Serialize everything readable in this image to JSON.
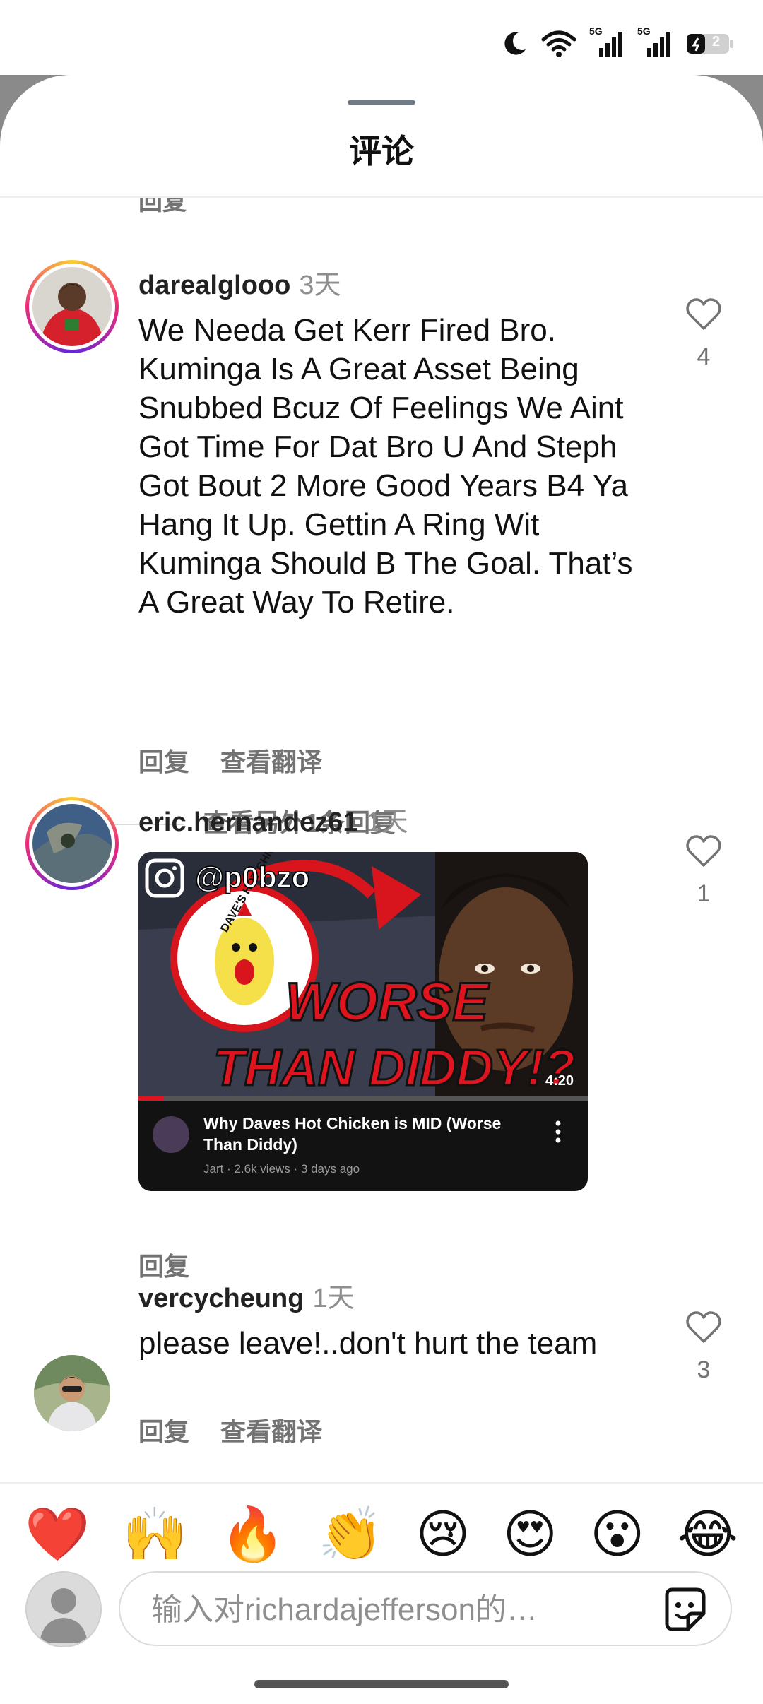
{
  "status_bar": {
    "icons": [
      "moon-icon",
      "wifi-icon",
      "signal-5g-icon",
      "signal-5g-icon",
      "battery-icon"
    ],
    "network_label_1": "5G",
    "network_label_2": "5G",
    "battery_level": "2"
  },
  "sheet": {
    "title": "评论"
  },
  "partial_reply_label": "回复",
  "comments": [
    {
      "username": "darealglooo",
      "time": "3天",
      "text": "We Needa Get Kerr Fired Bro. Kuminga Is A Great Asset Being Snubbed Bcuz Of Feelings We Aint Got Time For Dat Bro U And Steph Got Bout 2 More Good Years B4 Ya Hang It Up. Gettin A Ring Wit Kuminga Should B The Goal. That’s A Great Way To Retire.",
      "reply_label": "回复",
      "translate_label": "查看翻译",
      "likes": "4",
      "more_replies": "查看另外1条回复"
    },
    {
      "username": "eric.hernandez61",
      "time": "1天",
      "reply_label": "回复",
      "likes": "1",
      "media": {
        "handle": "@p0bzo",
        "headline_1": "WORSE",
        "headline_2": "THAN DIDDY!?",
        "logo_text": "DAVE'S HOT CHICKEN",
        "duration": "4:20",
        "video_title": "Why Daves Hot Chicken is MID (Worse Than Diddy)",
        "video_meta": "Jart · 2.6k views · 3 days ago"
      }
    },
    {
      "username": "vercycheung",
      "time": "1天",
      "text": "please leave!..don't hurt the team",
      "reply_label": "回复",
      "translate_label": "查看翻译",
      "likes": "3"
    }
  ],
  "emoji_bar": [
    "❤️",
    "🙌",
    "🔥",
    "👏",
    "😢",
    "😍",
    "😮",
    "😂"
  ],
  "composer": {
    "placeholder": "输入对richardajefferson的…"
  }
}
